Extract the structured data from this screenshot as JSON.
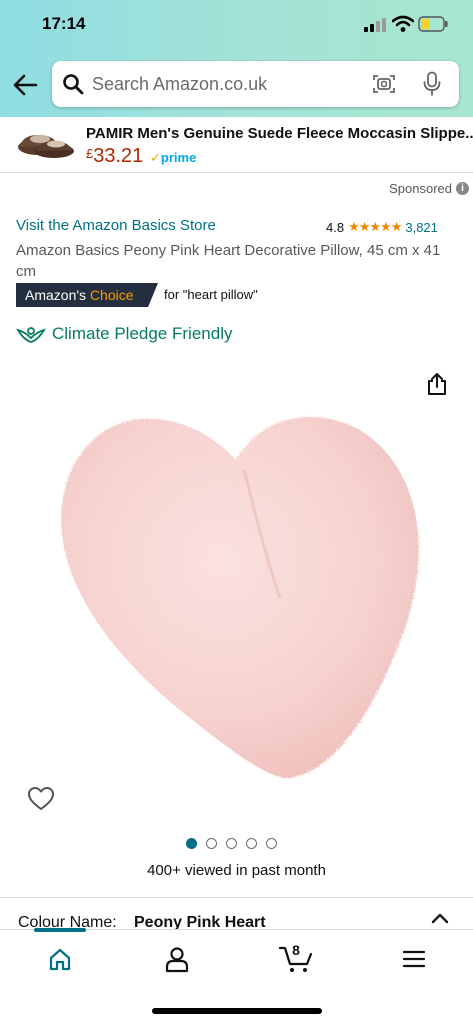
{
  "status_bar": {
    "time": "17:14"
  },
  "search": {
    "placeholder": "Search Amazon.co.uk"
  },
  "sponsored_ad": {
    "title": "PAMIR Men's Genuine Suede Fleece Moccasin Slippe...",
    "currency": "£",
    "price": "33.21",
    "prime_label": "prime"
  },
  "sponsored_label": "Sponsored",
  "product": {
    "store_link": "Visit the Amazon Basics Store",
    "rating": "4.8",
    "rating_count": "3,821",
    "stars_filled": 4.8,
    "title": "Amazon Basics Peony Pink Heart Decorative Pillow, 45 cm x 41 cm",
    "badge_prefix": "Amazon's",
    "badge_choice": "Choice",
    "badge_for": "for \"heart pillow\"",
    "climate_label": "Climate Pledge Friendly",
    "image_count": 5,
    "active_image": 0,
    "viewed_text": "400+ viewed in past month",
    "colour_label": "Colour Name:",
    "colour_value": "Peony Pink Heart"
  },
  "tabbar": {
    "cart_count": "8",
    "items": [
      "home",
      "account",
      "cart",
      "menu"
    ],
    "active": "home"
  },
  "colors": {
    "header_gradient_start": "#8fdde2",
    "header_gradient_end": "#a8e6cf",
    "link": "#007185",
    "price": "#b12704",
    "star": "#f08804",
    "climate": "#067d62",
    "badge_bg": "#232f3e"
  }
}
